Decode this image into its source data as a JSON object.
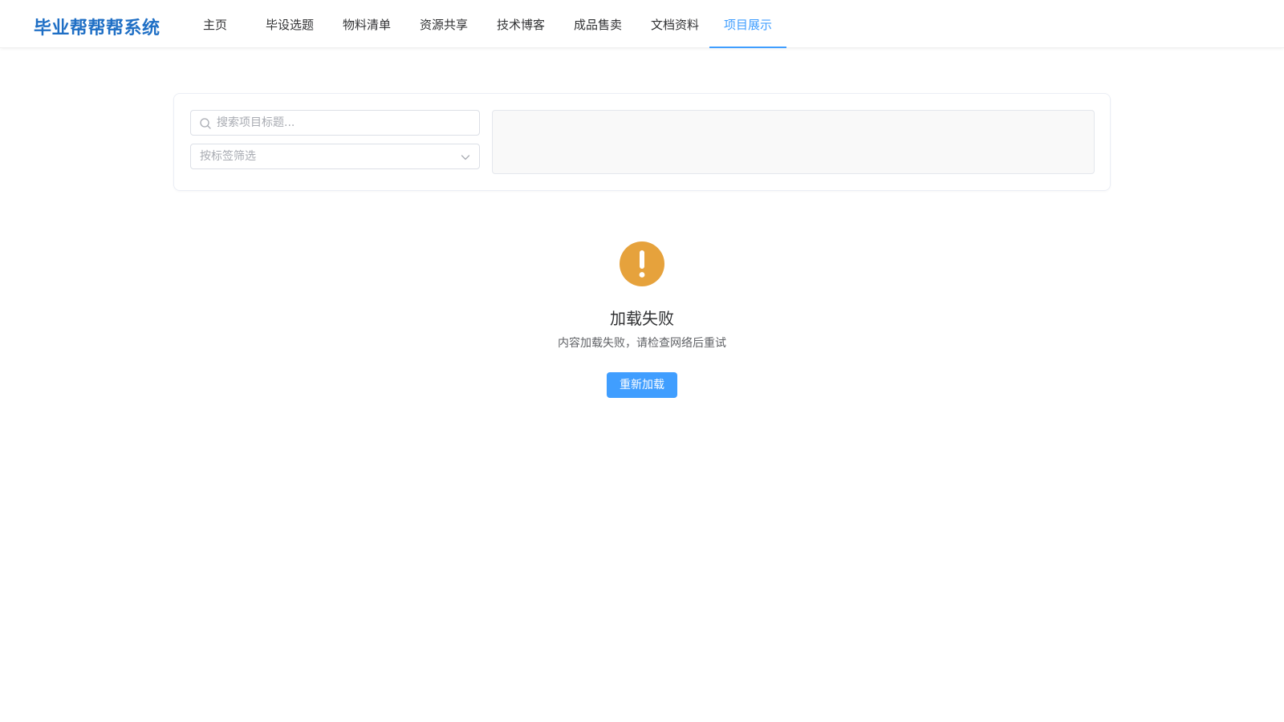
{
  "app": {
    "logo_text": "毕业帮帮帮系统"
  },
  "nav": {
    "items": [
      {
        "label": "主页"
      },
      {
        "label": "毕设选题"
      },
      {
        "label": "物料清单"
      },
      {
        "label": "资源共享"
      },
      {
        "label": "技术博客"
      },
      {
        "label": "成品售卖"
      },
      {
        "label": "文档资料"
      },
      {
        "label": "项目展示",
        "active": true
      }
    ]
  },
  "filters": {
    "search_placeholder": "搜索项目标题...",
    "search_value": "",
    "tag_select_placeholder": "按标签筛选",
    "search_icon": "search-icon",
    "tag_select_icon": "chevron-down-icon"
  },
  "error_state": {
    "icon": "warning-icon",
    "title": "加载失败",
    "description": "内容加载失败，请检查网络后重试",
    "reload_label": "重新加载"
  },
  "colors": {
    "brand": "#1f6fc5",
    "primary": "#409eff",
    "warning": "#e6a23c"
  }
}
